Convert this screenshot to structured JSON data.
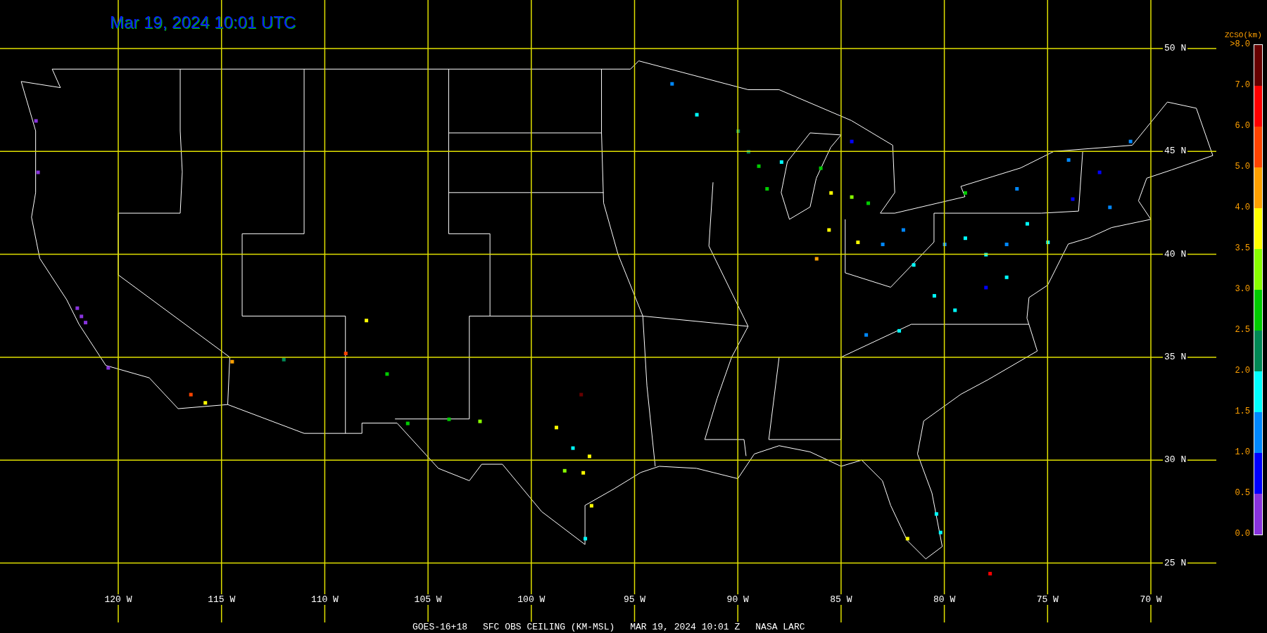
{
  "title": "Mar 19, 2024 10:01 UTC",
  "map": {
    "latitude_labels": [
      "50 N",
      "45 N",
      "40 N",
      "35 N",
      "30 N",
      "25 N"
    ],
    "longitude_labels": [
      "120 W",
      "115 W",
      "110 W",
      "105 W",
      "100 W",
      "95 W",
      "90 W",
      "85 W",
      "80 W",
      "75 W",
      "70 W"
    ]
  },
  "legend": {
    "title": "ZCSO(km)",
    "ticks": [
      ">8.0",
      "7.0",
      "6.0",
      "5.0",
      "4.0",
      "3.5",
      "3.0",
      "2.5",
      "2.0",
      "1.5",
      "1.0",
      "0.5",
      "0.0"
    ],
    "segments": [
      {
        "color": "#660000"
      },
      {
        "color": "#ff0000"
      },
      {
        "color": "#ff4400"
      },
      {
        "color": "#ffa000"
      },
      {
        "color": "#ffff00"
      },
      {
        "color": "#88ff00"
      },
      {
        "color": "#00cc00"
      },
      {
        "color": "#008855"
      },
      {
        "color": "#00ffff"
      },
      {
        "color": "#0088ff"
      },
      {
        "color": "#0000ff"
      },
      {
        "color": "#8833dd"
      }
    ]
  },
  "caption": [
    "GOES-16+18",
    "SFC OBS CEILING (KM-MSL)",
    "MAR 19, 2024 10:01 Z",
    "NASA LARC"
  ]
}
